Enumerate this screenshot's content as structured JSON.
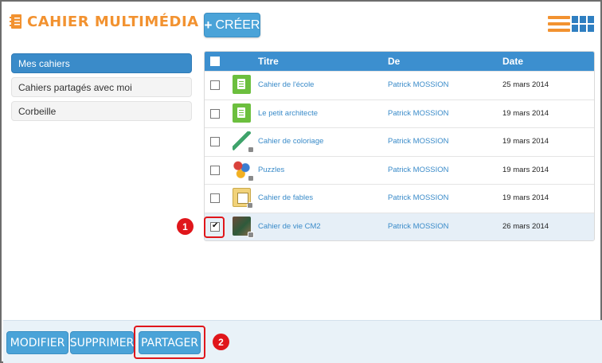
{
  "header": {
    "app_title": "CAHIER MULTIMÉDIA",
    "create_label": "CRÉER",
    "create_icon": "plus-icon",
    "view_list_icon": "list-view-icon",
    "view_grid_icon": "grid-view-icon"
  },
  "sidebar": {
    "items": [
      {
        "label": "Mes cahiers",
        "active": true
      },
      {
        "label": "Cahiers partagés avec moi",
        "active": false
      },
      {
        "label": "Corbeille",
        "active": false
      }
    ]
  },
  "table": {
    "columns": [
      "Titre",
      "De",
      "Date"
    ],
    "rows": [
      {
        "title": "Cahier de l'école",
        "author": "Patrick MOSSION",
        "date": "25 mars 2014",
        "checked": false,
        "thumb": "notebook-icon"
      },
      {
        "title": "Le petit architecte",
        "author": "Patrick MOSSION",
        "date": "19 mars 2014",
        "checked": false,
        "thumb": "notebook-icon"
      },
      {
        "title": "Cahier de coloriage",
        "author": "Patrick MOSSION",
        "date": "19 mars 2014",
        "checked": false,
        "thumb": "feather-icon"
      },
      {
        "title": "Puzzles",
        "author": "Patrick MOSSION",
        "date": "19 mars 2014",
        "checked": false,
        "thumb": "puzzle-icon"
      },
      {
        "title": "Cahier de fables",
        "author": "Patrick MOSSION",
        "date": "19 mars 2014",
        "checked": false,
        "thumb": "book-icon"
      },
      {
        "title": "Cahier de vie CM2",
        "author": "Patrick MOSSION",
        "date": "26 mars 2014",
        "checked": true,
        "thumb": "photo-icon"
      }
    ]
  },
  "actions": {
    "modify": "MODIFIER",
    "delete": "SUPPRIMER",
    "share": "PARTAGER"
  },
  "annotations": {
    "step1": "1",
    "step2": "2",
    "color": "#e0161b"
  },
  "colors": {
    "accent_orange": "#f29230",
    "primary_blue": "#3a8bc9",
    "button_blue": "#4aa3d8"
  }
}
